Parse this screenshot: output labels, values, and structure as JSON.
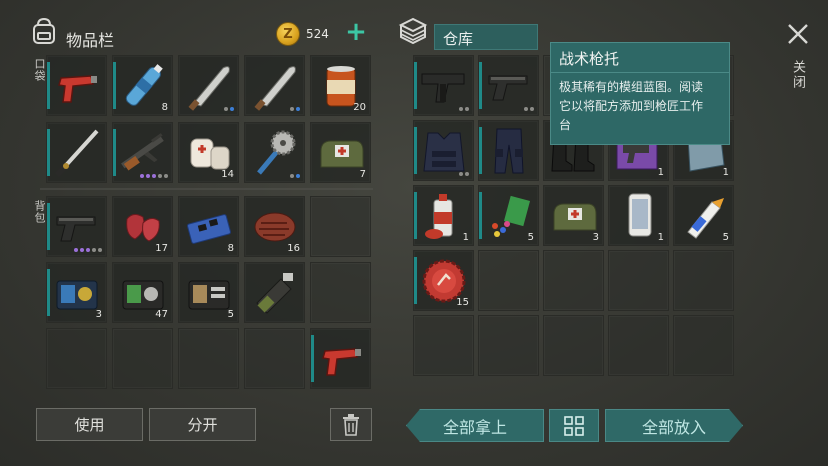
{
  "inventory": {
    "title": "物品栏",
    "coins": "524",
    "pocket_label": "口袋",
    "backpack_label": "背包",
    "pocket_slots": [
      {
        "icon": "flare-gun-icon",
        "qty": "",
        "dots": ""
      },
      {
        "icon": "water-bottle-icon",
        "qty": "8",
        "dots": ""
      },
      {
        "icon": "machete-icon",
        "qty": "",
        "dots": "gb"
      },
      {
        "icon": "machete-icon",
        "qty": "",
        "dots": "gb"
      },
      {
        "icon": "canned-food-icon",
        "qty": "20",
        "dots": ""
      },
      {
        "icon": "katana-icon",
        "qty": "",
        "dots": ""
      },
      {
        "icon": "assault-rifle-icon",
        "qty": "",
        "dots": "pppgg"
      },
      {
        "icon": "bandage-icon",
        "qty": "14",
        "dots": ""
      },
      {
        "icon": "saw-mace-icon",
        "qty": "",
        "dots": "gb"
      },
      {
        "icon": "medkit-bag-icon",
        "qty": "7",
        "dots": ""
      }
    ],
    "backpack_slots": [
      {
        "icon": "pistol-icon",
        "qty": "",
        "dots": "pppgg"
      },
      {
        "icon": "raw-meat-icon",
        "qty": "17",
        "dots": ""
      },
      {
        "icon": "circuit-board-icon",
        "qty": "8",
        "dots": ""
      },
      {
        "icon": "steak-icon",
        "qty": "16",
        "dots": ""
      },
      {
        "icon": "",
        "qty": "",
        "dots": ""
      },
      {
        "icon": "police-badge-wallet-icon",
        "qty": "3",
        "dots": ""
      },
      {
        "icon": "id-wallet-green-icon",
        "qty": "47",
        "dots": ""
      },
      {
        "icon": "id-wallet-brown-icon",
        "qty": "5",
        "dots": ""
      },
      {
        "icon": "weapon-blueprint-icon",
        "qty": "",
        "dots": ""
      },
      {
        "icon": "",
        "qty": "",
        "dots": ""
      },
      {
        "icon": "",
        "qty": "",
        "dots": ""
      },
      {
        "icon": "",
        "qty": "",
        "dots": ""
      },
      {
        "icon": "",
        "qty": "",
        "dots": ""
      },
      {
        "icon": "",
        "qty": "",
        "dots": ""
      },
      {
        "icon": "flare-gun-icon",
        "qty": "",
        "dots": ""
      }
    ],
    "use_label": "使用",
    "split_label": "分开"
  },
  "storage": {
    "title": "仓库",
    "slots": [
      {
        "icon": "smg-icon",
        "qty": "",
        "dots": "gg"
      },
      {
        "icon": "pistol-icon",
        "qty": "",
        "dots": "gg"
      },
      {
        "icon": "",
        "qty": "",
        "dots": ""
      },
      {
        "icon": "",
        "qty": "",
        "dots": ""
      },
      {
        "icon": "",
        "qty": "",
        "dots": ""
      },
      {
        "icon": "tactical-vest-icon",
        "qty": "",
        "dots": "gg"
      },
      {
        "icon": "tactical-pants-icon",
        "qty": "",
        "dots": ""
      },
      {
        "icon": "boots-icon",
        "qty": "",
        "dots": ""
      },
      {
        "icon": "purple-blueprint-icon",
        "qty": "1",
        "dots": ""
      },
      {
        "icon": "glass-shard-icon",
        "qty": "1",
        "dots": ""
      },
      {
        "icon": "spray-paint-icon",
        "qty": "1",
        "dots": ""
      },
      {
        "icon": "pills-icon",
        "qty": "5",
        "dots": ""
      },
      {
        "icon": "medkit-bag-icon",
        "qty": "3",
        "dots": ""
      },
      {
        "icon": "smartphone-icon",
        "qty": "1",
        "dots": ""
      },
      {
        "icon": "glue-icon",
        "qty": "5",
        "dots": ""
      },
      {
        "icon": "bottle-cap-icon",
        "qty": "15",
        "dots": ""
      }
    ],
    "take_all_label": "全部拿上",
    "put_all_label": "全部放入"
  },
  "tooltip": {
    "title": "战术枪托",
    "description_line1": "极其稀有的模组蓝图。阅读",
    "description_line2": "它以将配方添加到枪匠工作",
    "description_line3": "台"
  },
  "close_label": "关闭",
  "colors": {
    "accent": "#1f8a88",
    "teal_button": "#2f6967",
    "plus": "#3cc6a4",
    "coin": "#d9a21e"
  }
}
